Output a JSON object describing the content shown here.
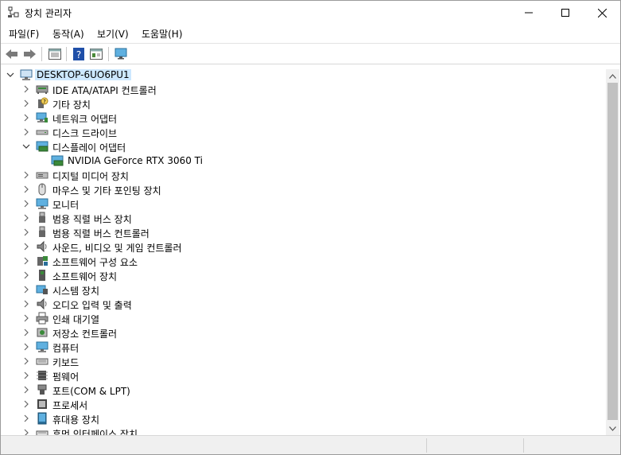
{
  "window": {
    "title": "장치 관리자"
  },
  "menu": [
    "파일(F)",
    "동작(A)",
    "보기(V)",
    "도움말(H)"
  ],
  "toolbar": [
    "back-icon",
    "forward-icon",
    "properties-icon",
    "help-icon",
    "view-icon",
    "monitor-scan-icon"
  ],
  "tree": {
    "root": "DESKTOP-6UO6PU1",
    "categories": [
      {
        "label": "IDE ATA/ATAPI 컨트롤러",
        "icon": "ide-controller-icon",
        "expanded": false
      },
      {
        "label": "기타 장치",
        "icon": "unknown-device-icon",
        "expanded": false
      },
      {
        "label": "네트워크 어댑터",
        "icon": "network-adapter-icon",
        "expanded": false
      },
      {
        "label": "디스크 드라이브",
        "icon": "disk-drive-icon",
        "expanded": false
      },
      {
        "label": "디스플레이 어댑터",
        "icon": "display-adapter-icon",
        "expanded": true,
        "children": [
          {
            "label": "NVIDIA GeForce RTX 3060 Ti",
            "icon": "display-adapter-icon"
          }
        ]
      },
      {
        "label": "디지털 미디어 장치",
        "icon": "digital-media-icon",
        "expanded": false
      },
      {
        "label": "마우스 및 기타 포인팅 장치",
        "icon": "mouse-icon",
        "expanded": false
      },
      {
        "label": "모니터",
        "icon": "monitor-icon",
        "expanded": false
      },
      {
        "label": "범용 직렬 버스 장치",
        "icon": "usb-icon",
        "expanded": false
      },
      {
        "label": "범용 직렬 버스 컨트롤러",
        "icon": "usb-icon",
        "expanded": false
      },
      {
        "label": "사운드, 비디오 및 게임 컨트롤러",
        "icon": "speaker-icon",
        "expanded": false
      },
      {
        "label": "소프트웨어 구성 요소",
        "icon": "software-component-icon",
        "expanded": false
      },
      {
        "label": "소프트웨어 장치",
        "icon": "software-device-icon",
        "expanded": false
      },
      {
        "label": "시스템 장치",
        "icon": "system-device-icon",
        "expanded": false
      },
      {
        "label": "오디오 입력 및 출력",
        "icon": "speaker-icon",
        "expanded": false
      },
      {
        "label": "인쇄 대기열",
        "icon": "printer-icon",
        "expanded": false
      },
      {
        "label": "저장소 컨트롤러",
        "icon": "storage-controller-icon",
        "expanded": false
      },
      {
        "label": "컴퓨터",
        "icon": "computer-icon",
        "expanded": false
      },
      {
        "label": "키보드",
        "icon": "keyboard-icon",
        "expanded": false
      },
      {
        "label": "펌웨어",
        "icon": "firmware-icon",
        "expanded": false
      },
      {
        "label": "포트(COM & LPT)",
        "icon": "port-icon",
        "expanded": false
      },
      {
        "label": "프로세서",
        "icon": "processor-icon",
        "expanded": false
      },
      {
        "label": "휴대용 장치",
        "icon": "portable-device-icon",
        "expanded": false
      },
      {
        "label": "휴먼 인터페이스 장치",
        "icon": "hid-icon",
        "expanded": false
      }
    ]
  },
  "colors": {
    "selection": "#cde8ff",
    "scroll_track": "#f0f0f0",
    "scroll_thumb": "#c1c1c1"
  }
}
